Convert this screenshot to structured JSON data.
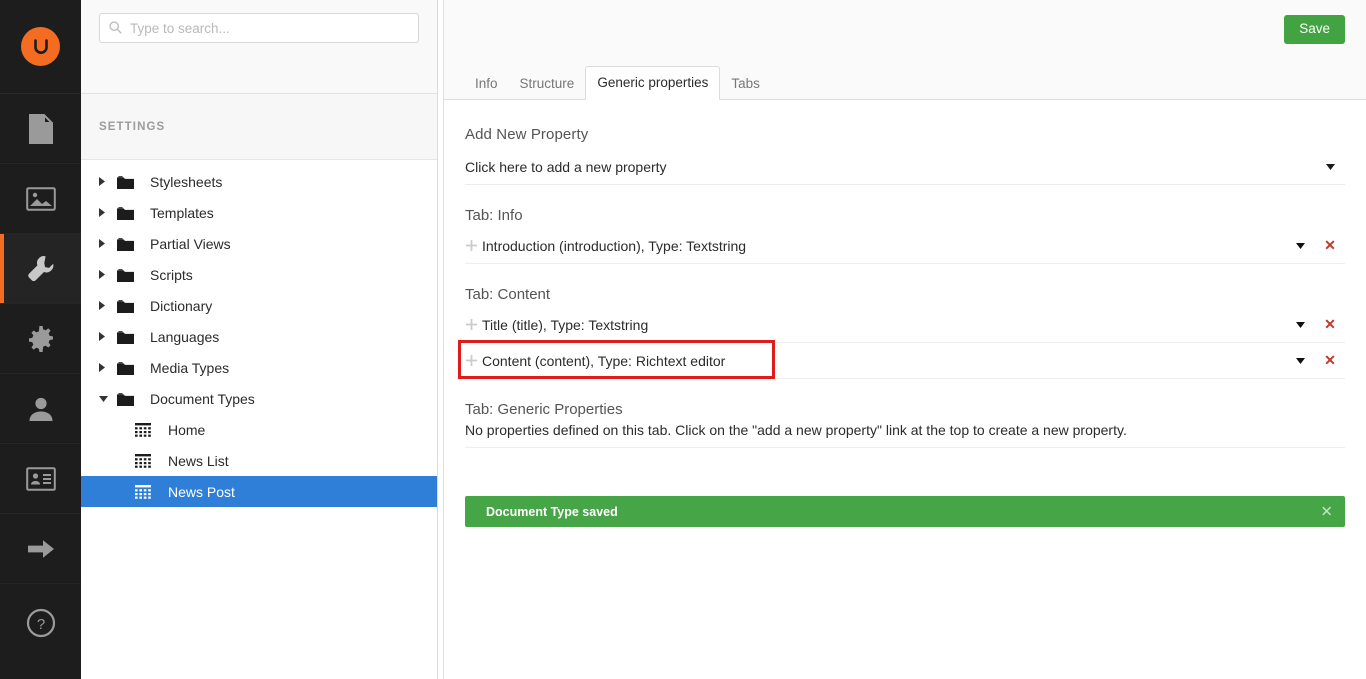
{
  "rail": {
    "logo_name": "umbraco-logo",
    "logo_color": "#f36c21",
    "items": [
      {
        "name": "content-section",
        "icon": "document-icon",
        "active": false
      },
      {
        "name": "media-section",
        "icon": "image-icon",
        "active": false
      },
      {
        "name": "settings-section",
        "icon": "wrench-icon",
        "active": true
      },
      {
        "name": "developer-section",
        "icon": "gear-icon",
        "active": false
      },
      {
        "name": "users-section",
        "icon": "user-icon",
        "active": false
      },
      {
        "name": "members-section",
        "icon": "member-card-icon",
        "active": false
      },
      {
        "name": "translation-section",
        "icon": "arrow-right-icon",
        "active": false
      },
      {
        "name": "help-section",
        "icon": "question-circle-icon",
        "active": false
      }
    ]
  },
  "search": {
    "placeholder": "Type to search...",
    "value": "",
    "icon": "search-icon"
  },
  "tree": {
    "section_title": "SETTINGS",
    "items": [
      {
        "label": "Stylesheets",
        "icon": "folder-icon",
        "caret": "right",
        "child": false,
        "selected": false
      },
      {
        "label": "Templates",
        "icon": "folder-icon",
        "caret": "right",
        "child": false,
        "selected": false
      },
      {
        "label": "Partial Views",
        "icon": "folder-icon",
        "caret": "right",
        "child": false,
        "selected": false
      },
      {
        "label": "Scripts",
        "icon": "folder-icon",
        "caret": "right",
        "child": false,
        "selected": false
      },
      {
        "label": "Dictionary",
        "icon": "folder-icon",
        "caret": "right",
        "child": false,
        "selected": false
      },
      {
        "label": "Languages",
        "icon": "folder-icon",
        "caret": "right",
        "child": false,
        "selected": false
      },
      {
        "label": "Media Types",
        "icon": "folder-icon",
        "caret": "right",
        "child": false,
        "selected": false
      },
      {
        "label": "Document Types",
        "icon": "folder-icon",
        "caret": "down",
        "child": false,
        "selected": false
      },
      {
        "label": "Home",
        "icon": "doctype-icon",
        "caret": "none",
        "child": true,
        "selected": false
      },
      {
        "label": "News List",
        "icon": "doctype-icon",
        "caret": "none",
        "child": true,
        "selected": false
      },
      {
        "label": "News Post",
        "icon": "doctype-icon",
        "caret": "none",
        "child": true,
        "selected": true
      }
    ],
    "selected_color": "#2f7fd8"
  },
  "header": {
    "save_label": "Save",
    "save_color": "#41a341"
  },
  "tabs": [
    {
      "label": "Info",
      "active": false
    },
    {
      "label": "Structure",
      "active": false
    },
    {
      "label": "Generic properties",
      "active": true
    },
    {
      "label": "Tabs",
      "active": false
    }
  ],
  "main": {
    "add_new_label": "Add New Property",
    "add_new_value": "Click here to add a new property",
    "groups": [
      {
        "title": "Tab: Info",
        "properties": [
          {
            "label": "Introduction (introduction), Type: Textstring",
            "handle": "drag-handle-icon",
            "highlighted": false
          }
        ],
        "empty_note": ""
      },
      {
        "title": "Tab: Content",
        "properties": [
          {
            "label": "Title (title), Type: Textstring",
            "handle": "drag-handle-icon",
            "highlighted": false
          },
          {
            "label": "Content (content), Type: Richtext editor",
            "handle": "drag-handle-icon",
            "highlighted": true
          }
        ],
        "empty_note": ""
      },
      {
        "title": "Tab: Generic Properties",
        "properties": [],
        "empty_note": "No properties defined on this tab. Click on the \"add a new property\" link at the top to create a new property."
      }
    ]
  },
  "notification": {
    "message": "Document Type saved",
    "color": "#46a546",
    "close_icon": "close-icon"
  },
  "annotation": {
    "highlight_color": "#e01b1b",
    "target": "Content (content), Type: Richtext editor"
  }
}
